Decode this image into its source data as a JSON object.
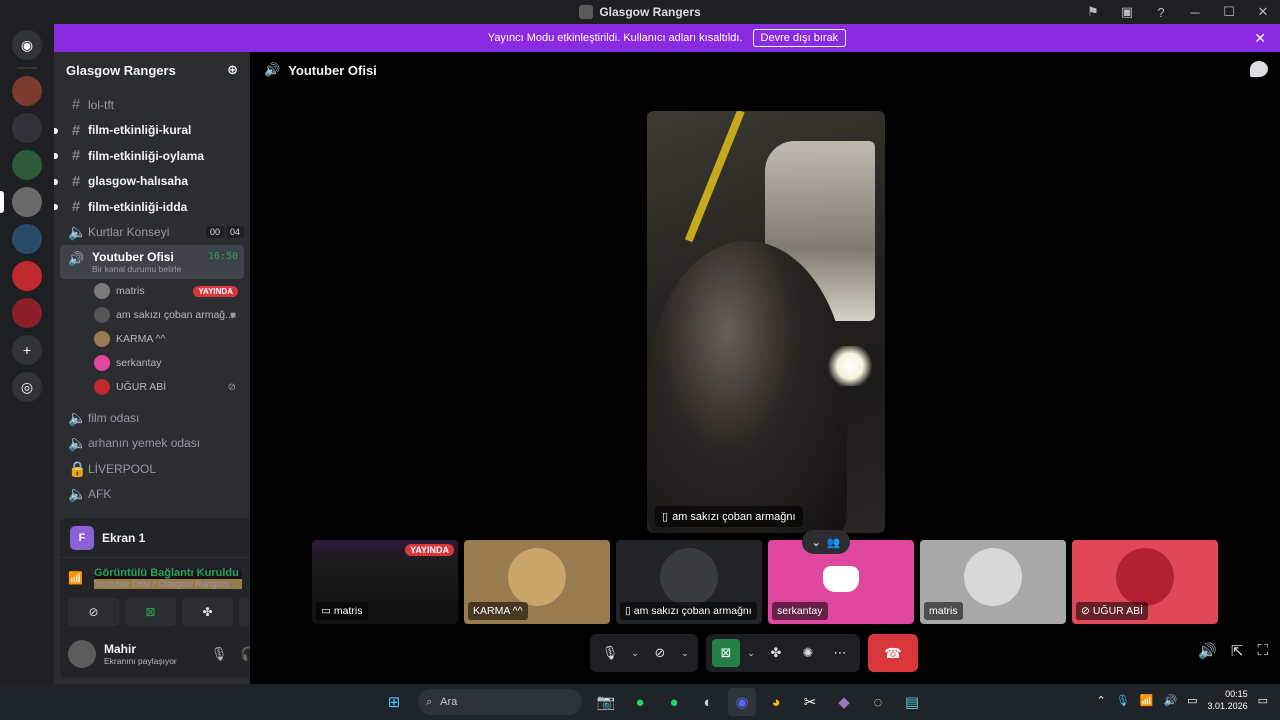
{
  "window": {
    "title": "Glasgow Rangers"
  },
  "banner": {
    "message": "Yayıncı Modu etkinleştirildi. Kullanıcı adları kısaltıldı.",
    "button": "Devre dışı bırak"
  },
  "sidebar": {
    "server_name": "Glasgow Rangers",
    "channels": [
      {
        "name": "lol-tft",
        "type": "text",
        "unread": false
      },
      {
        "name": "film-etkinliği-kural",
        "type": "text",
        "unread": true
      },
      {
        "name": "film-etkinliği-oylama",
        "type": "text",
        "unread": true
      },
      {
        "name": "glasgow-halısaha",
        "type": "text",
        "unread": true
      },
      {
        "name": "film-etkinliği-idda",
        "type": "text",
        "unread": true
      }
    ],
    "kurtlar": {
      "name": "Kurtlar Konseyi",
      "count_a": "00",
      "count_b": "04"
    },
    "active_voice": {
      "name": "Youtuber Ofisi",
      "status": "Bir kanal durumu belirle",
      "timer": "16:50",
      "members": [
        {
          "name": "matris",
          "badge": "YAYINDA"
        },
        {
          "name": "am sakızı çoban armağ..."
        },
        {
          "name": "KARMA ^^"
        },
        {
          "name": "serkantay"
        },
        {
          "name": "UĞUR ABİ"
        }
      ]
    },
    "voice_channels": [
      "film odası",
      "arhanın yemek odası",
      "LİVERPOOL",
      "AFK"
    ]
  },
  "voice_panel": {
    "screen_label": "Ekran 1",
    "screen_avatar": "F",
    "connection": "Görüntülü Bağlantı Kuruldu",
    "location": "Youtuber Ofisi / Glasgow Rangers"
  },
  "user": {
    "name": "Mahir",
    "status": "Ekranını paylaşıyor"
  },
  "main": {
    "channel_title": "Youtuber Ofisi",
    "stage_label": "am sakızı çoban armağnı",
    "tiles": [
      {
        "name": "matris",
        "badge": "YAYINDA"
      },
      {
        "name": "KARMA ^^"
      },
      {
        "name": "am sakızı çoban armağnı"
      },
      {
        "name": "serkantay"
      },
      {
        "name": "matris"
      },
      {
        "name": "UĞUR ABİ"
      }
    ]
  },
  "taskbar": {
    "search_placeholder": "Ara",
    "time": "00:15",
    "date": "3.01.2026"
  },
  "colors": {
    "banner": "#8a2be2",
    "live": "#da373c",
    "green": "#23a55a",
    "hangup": "#da373c"
  }
}
